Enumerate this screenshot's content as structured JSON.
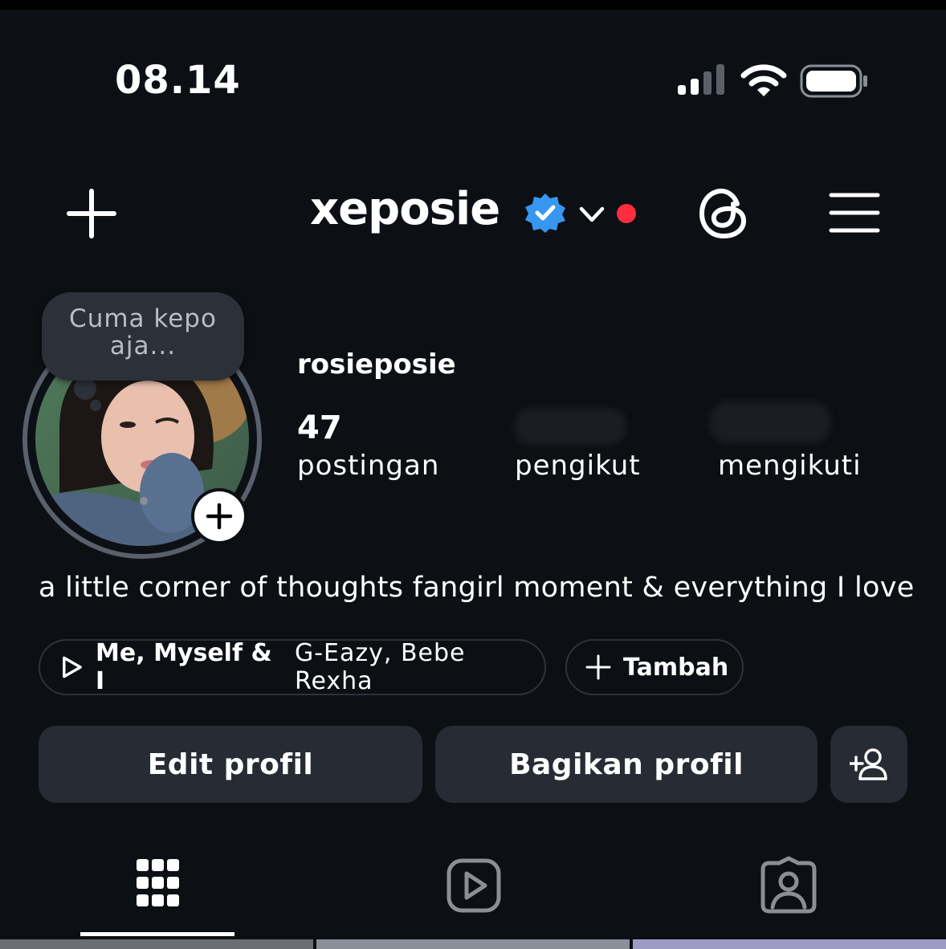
{
  "status_bar": {
    "time": "08.14"
  },
  "header": {
    "username": "xeposie"
  },
  "profile": {
    "note": "Cuma kepo aja...",
    "display_name": "rosieposie",
    "stats": {
      "posts": {
        "value": "47",
        "label": "postingan"
      },
      "followers": {
        "value": "",
        "label": "pengikut"
      },
      "following": {
        "value": "",
        "label": "mengikuti"
      }
    },
    "bio": "a little corner of thoughts fangirl moment & everything I love"
  },
  "chips": {
    "music": {
      "song": "Me, Myself & I",
      "artist": "G-Eazy, Bebe Rexha"
    },
    "add_label": "Tambah"
  },
  "buttons": {
    "edit": "Edit profil",
    "share": "Bagikan profil"
  },
  "tabs": [
    {
      "icon": "grid-icon",
      "selected": true
    },
    {
      "icon": "reels-icon",
      "selected": false
    },
    {
      "icon": "tagged-icon",
      "selected": false
    }
  ],
  "colors": {
    "background": "#0c0f14",
    "button": "#272b33",
    "verified": "#3797f0",
    "notification_dot": "#ff2d3d"
  }
}
